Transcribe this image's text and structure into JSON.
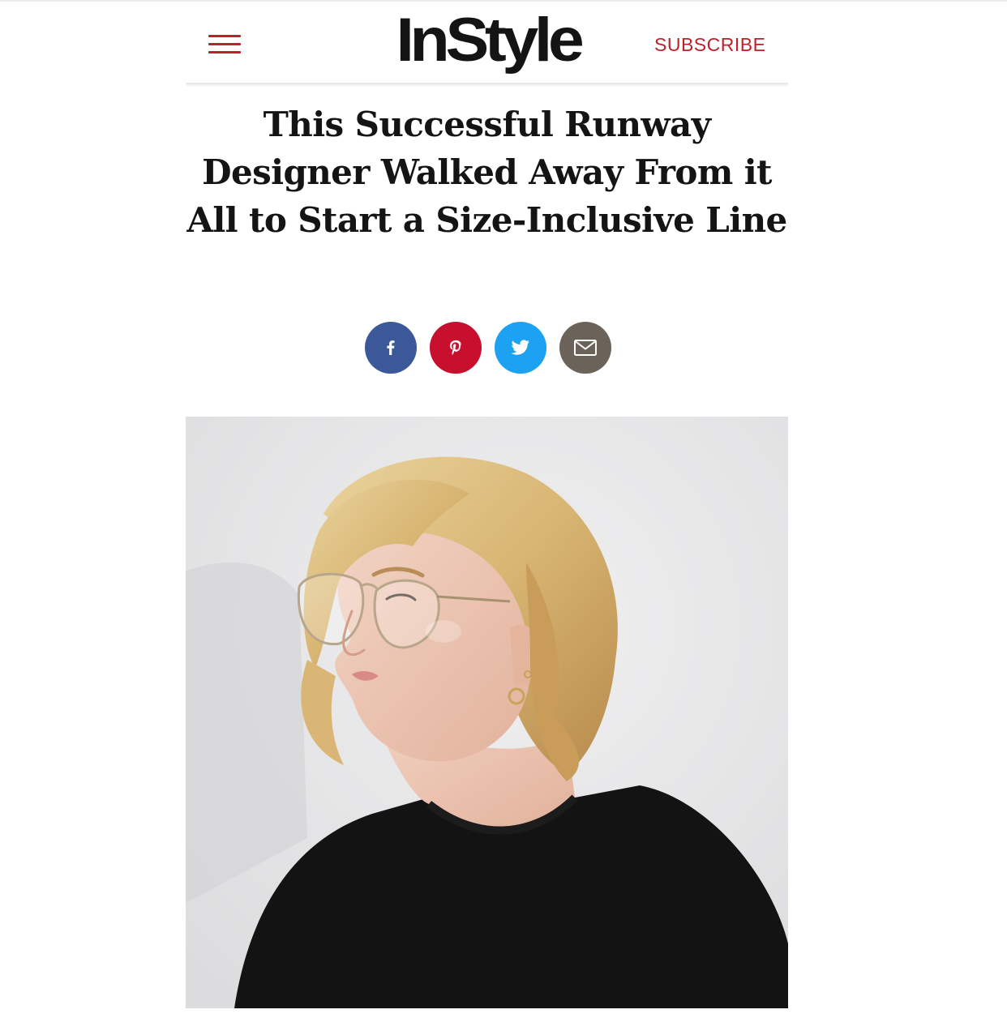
{
  "header": {
    "logo_text": "InStyle",
    "subscribe_label": "SUBSCRIBE",
    "menu_icon": "hamburger-menu-icon"
  },
  "article": {
    "headline": "This Successful Runway Designer Walked Away From it All to Start a Size-Inclusive Line"
  },
  "share": {
    "buttons": [
      {
        "network": "facebook",
        "icon": "facebook-icon",
        "color": "#3b5998"
      },
      {
        "network": "pinterest",
        "icon": "pinterest-icon",
        "color": "#c8102e"
      },
      {
        "network": "twitter",
        "icon": "twitter-icon",
        "color": "#1da1f2"
      },
      {
        "network": "email",
        "icon": "mail-icon",
        "color": "#6b625a"
      }
    ]
  },
  "hero_image": {
    "subject": "portrait-photo",
    "background": "#e8e8e9"
  },
  "colors": {
    "accent": "#c0202a",
    "text": "#141414"
  }
}
